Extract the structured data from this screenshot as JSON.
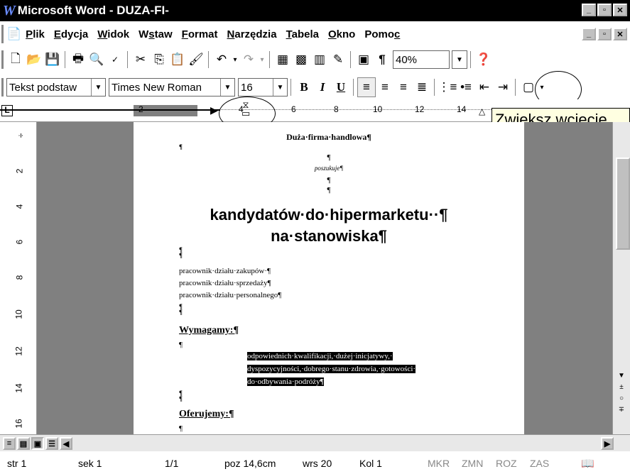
{
  "title": "Microsoft Word - DUZA-FI-",
  "menu": [
    "Plik",
    "Edycja",
    "Widok",
    "Wstaw",
    "Format",
    "Narzędzia",
    "Tabela",
    "Okno",
    "Pomoc"
  ],
  "menu_hotkeys": [
    "P",
    "E",
    "W",
    "s",
    "F",
    "N",
    "T",
    "O",
    "c"
  ],
  "zoom": "40%",
  "style": "Tekst podstaw",
  "font": "Times New Roman",
  "size": "16",
  "tooltip": "Zwiększ wcięcie",
  "ruler_h": [
    "2",
    "4",
    "6",
    "8",
    "10",
    "12",
    "14"
  ],
  "ruler_v": [
    "2",
    "4",
    "6",
    "8",
    "10",
    "12",
    "14",
    "16"
  ],
  "doc": {
    "heading": "Duża·firma·handlowa¶",
    "p1": "¶",
    "poszukuje": "poszukuje¶",
    "p2": "¶",
    "p3": "¶",
    "big1": "kandydatów·do·hipermarketu··¶",
    "big2": "na·stanowiska¶",
    "l1": "pracownik·działu·zakupów·¶",
    "l2": "pracownik·działu·sprzedaży¶",
    "l3": "pracownik·działu·personalnego¶",
    "wym": "Wymagamy:¶",
    "p4": "¶",
    "sel1": "odpowiednich·kwalifikacji,·dużej·inicjatywy,·",
    "sel2": "dyspozycyjności,·dobrego·stanu·zdrowia,·gotowości·",
    "sel3": "do·odbywania·podróży¶",
    "ofe": "Oferujemy:¶",
    "p5": "¶"
  },
  "status": {
    "str": "str 1",
    "sek": "sek 1",
    "pages": "1/1",
    "poz": "poz 14,6cm",
    "wrs": "wrs 20",
    "kol": "Kol 1",
    "mkr": "MKR",
    "zmn": "ZMN",
    "roz": "ROZ",
    "zas": "ZAS"
  }
}
